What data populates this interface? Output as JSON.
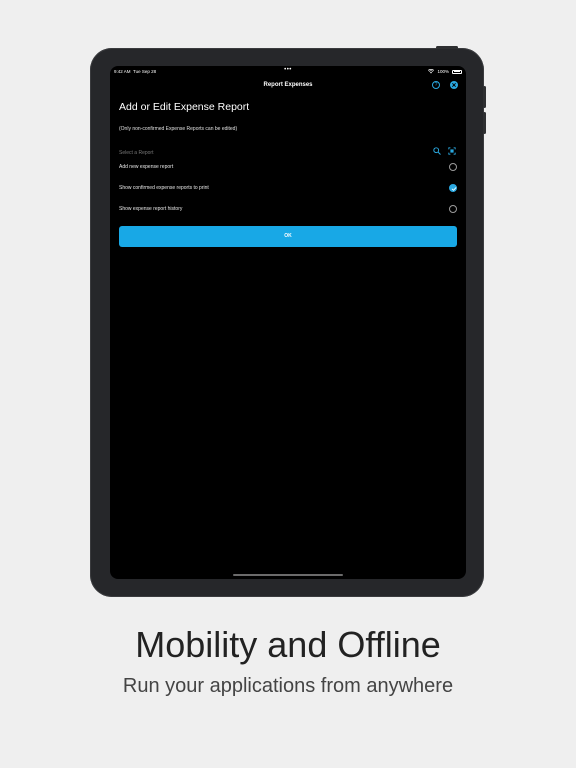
{
  "status_bar": {
    "time": "9:42 AM",
    "date": "Tue Sep 28",
    "dots": "•••",
    "battery": "100%"
  },
  "navbar": {
    "title": "Report Expenses",
    "help_icon": "help-icon",
    "close_icon": "close-icon"
  },
  "page": {
    "title": "Add or Edit Expense Report",
    "note": "(Only non-confirmed Expense Reports can be edited)"
  },
  "select": {
    "label": "Select a Report",
    "icons": [
      "search-icon",
      "scan-icon"
    ]
  },
  "options": [
    {
      "label": "Add new expense report",
      "checked": false
    },
    {
      "label": "Show confirmed expense reports to print",
      "checked": true
    },
    {
      "label": "Show expense report history",
      "checked": false
    }
  ],
  "ok_button": "OK",
  "colors": {
    "accent": "#18a8e6",
    "background": "#efefef",
    "screen": "#000000"
  },
  "marketing": {
    "headline": "Mobility and Offline",
    "subline": "Run your applications from anywhere"
  }
}
